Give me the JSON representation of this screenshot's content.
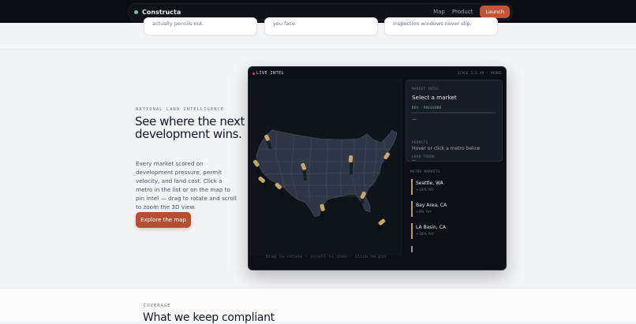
{
  "nav": {
    "brand": "Constructa",
    "links": [
      "Map",
      "Product"
    ],
    "cta": "Launch"
  },
  "cards": [
    {
      "text": "actually pencils out."
    },
    {
      "text": "you face."
    },
    {
      "text": "inspection windows never slip."
    }
  ],
  "hero": {
    "eyebrow": "NATIONAL LAND INTELLIGENCE",
    "title": "See where the next development wins.",
    "lead": "Every market scored on development pressure, permit velocity, and land cost. Click a metro in the list or on the map to pin intel — drag to rotate and scroll to zoom the 3D view.",
    "button": "Explore the map"
  },
  "panel": {
    "live": "LIVE INTEL",
    "scale": "SCALE 1:2.4M · MARKS",
    "hint": "Drag to rotate · scroll to zoom · click to pin",
    "intel": {
      "label": "MARKET INTEL",
      "title": "Select a market",
      "dev_label": "DEV. PRESSURE",
      "dev_value": "—",
      "permits_label": "PERMITS",
      "permits_value": "Hover or click a metro below",
      "land_label": "LAND TREND",
      "land_value": "—"
    },
    "metro_header": "METRO MARKETS",
    "metros": [
      {
        "name": "Seattle, WA",
        "change": "+14% YoY"
      },
      {
        "name": "Bay Area, CA",
        "change": "+9% YoY"
      },
      {
        "name": "LA Basin, CA",
        "change": "+18% YoY"
      }
    ]
  },
  "coverage": {
    "eyebrow": "COVERAGE",
    "title": "What we keep compliant"
  },
  "colors": {
    "accent": "#c05636",
    "map_fill": "#2f3746",
    "pin": "#c9a76a",
    "metro_accent": "#b79e6a",
    "intel_dev": "#7bbfa0"
  }
}
